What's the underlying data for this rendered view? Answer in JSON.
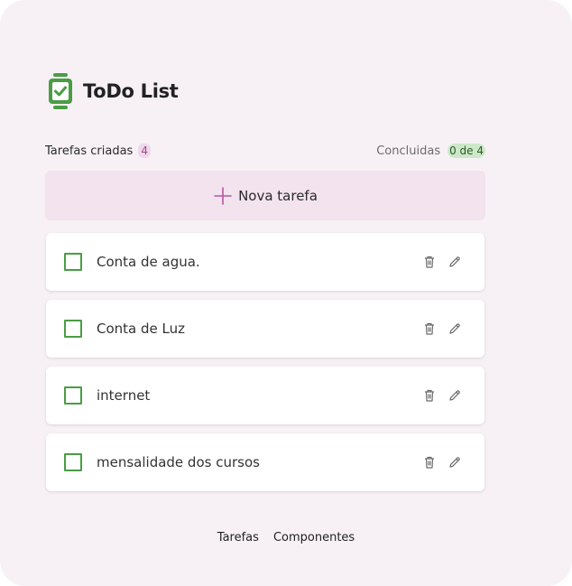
{
  "app": {
    "title": "ToDo List",
    "accent_color": "#4a9d44",
    "highlight_color": "#f2e3ee"
  },
  "stats": {
    "created_label": "Tarefas criadas",
    "created_count": "4",
    "done_label": "Concluidas",
    "done_value": "0 de 4"
  },
  "new_task": {
    "label": "Nova tarefa",
    "icon": "plus-icon"
  },
  "tasks": [
    {
      "text": "Conta de agua.",
      "done": false
    },
    {
      "text": "Conta de Luz",
      "done": false
    },
    {
      "text": "internet",
      "done": false
    },
    {
      "text": "mensalidade dos cursos",
      "done": false
    }
  ],
  "task_actions": {
    "delete_icon": "trash-icon",
    "edit_icon": "pencil-icon"
  },
  "footer": {
    "links": [
      "Tarefas",
      "Componentes"
    ]
  }
}
